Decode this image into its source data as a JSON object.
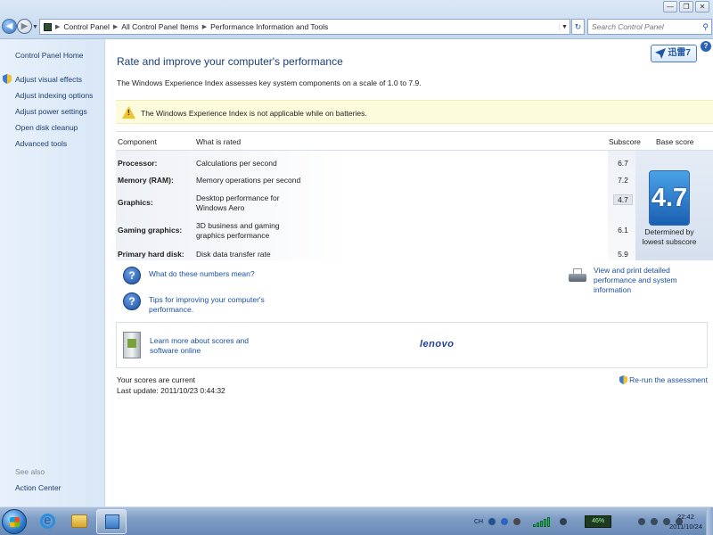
{
  "window": {
    "controls": {
      "minimize": "—",
      "restore": "❐",
      "close": "✕"
    }
  },
  "address": {
    "crumbs": [
      "Control Panel",
      "All Control Panel Items",
      "Performance Information and Tools"
    ],
    "search_placeholder": "Search Control Panel"
  },
  "leftnav": {
    "home": "Control Panel Home",
    "items": [
      "Adjust visual effects",
      "Adjust indexing options",
      "Adjust power settings",
      "Open disk cleanup",
      "Advanced tools"
    ],
    "see_also": "See also",
    "action_center": "Action Center"
  },
  "main": {
    "badge": "迅雷7",
    "help": "?",
    "title": "Rate and improve your computer's performance",
    "intro": "The Windows Experience Index assesses key system components on a scale of 1.0 to 7.9.",
    "warning": "The Windows Experience Index is not applicable while on batteries.",
    "table": {
      "headers": {
        "component": "Component",
        "rated": "What is rated",
        "subscore": "Subscore",
        "base": "Base score"
      },
      "rows": [
        {
          "component": "Processor:",
          "rated": "Calculations per second",
          "score": "6.7"
        },
        {
          "component": "Memory (RAM):",
          "rated": "Memory operations per second",
          "score": "7.2"
        },
        {
          "component": "Graphics:",
          "rated": "Desktop performance for Windows Aero",
          "score": "4.7"
        },
        {
          "component": "Gaming graphics:",
          "rated": "3D business and gaming graphics performance",
          "score": "6.1"
        },
        {
          "component": "Primary hard disk:",
          "rated": "Disk data transfer rate",
          "score": "5.9"
        }
      ],
      "base_score": "4.7",
      "base_note": "Determined by lowest subscore"
    },
    "links": {
      "what_numbers": "What do these numbers mean?",
      "tips": "Tips for improving your computer's performance.",
      "print": "View and print detailed performance and system information"
    },
    "oem": {
      "learn": "Learn more about scores and software online",
      "logo": "lenovo"
    },
    "status": {
      "current": "Your scores are current",
      "last_update": "Last update: 2011/10/23 0:44:32",
      "rerun": "Re-run the assessment"
    }
  },
  "taskbar": {
    "lang": "CH",
    "battery": "46%",
    "time": "22:42",
    "date": "2011/10/24"
  }
}
